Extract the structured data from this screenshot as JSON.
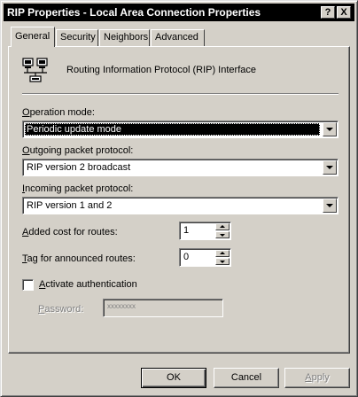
{
  "window": {
    "title": "RIP Properties - Local Area Connection Properties",
    "help_button": "?",
    "close_button": "X"
  },
  "tabs": [
    {
      "label": "General",
      "active": true
    },
    {
      "label": "Security",
      "active": false
    },
    {
      "label": "Neighbors",
      "active": false
    },
    {
      "label": "Advanced",
      "active": false
    }
  ],
  "header": {
    "icon": "network-computers-icon",
    "text": "Routing Information Protocol (RIP) Interface"
  },
  "operation_mode": {
    "label_accel": "O",
    "label_rest": "peration mode:",
    "value": "Periodic update mode"
  },
  "outgoing": {
    "label_accel": "O",
    "label_rest": "utgoing packet protocol:",
    "value": "RIP version 2 broadcast"
  },
  "incoming": {
    "label_accel": "I",
    "label_rest": "ncoming packet protocol:",
    "value": "RIP version 1 and 2"
  },
  "added_cost": {
    "label_accel": "A",
    "label_rest": "dded cost for routes:",
    "value": "1"
  },
  "tag": {
    "label_accel": "T",
    "label_rest": "ag for announced routes:",
    "value": "0"
  },
  "authentication": {
    "label_accel": "A",
    "label_rest": "ctivate authentication",
    "checked": false
  },
  "password": {
    "label_accel": "P",
    "label_rest": "assword:",
    "value": "xxxxxxxx"
  },
  "buttons": {
    "ok": "OK",
    "cancel": "Cancel",
    "apply_accel": "A",
    "apply_rest": "pply"
  }
}
